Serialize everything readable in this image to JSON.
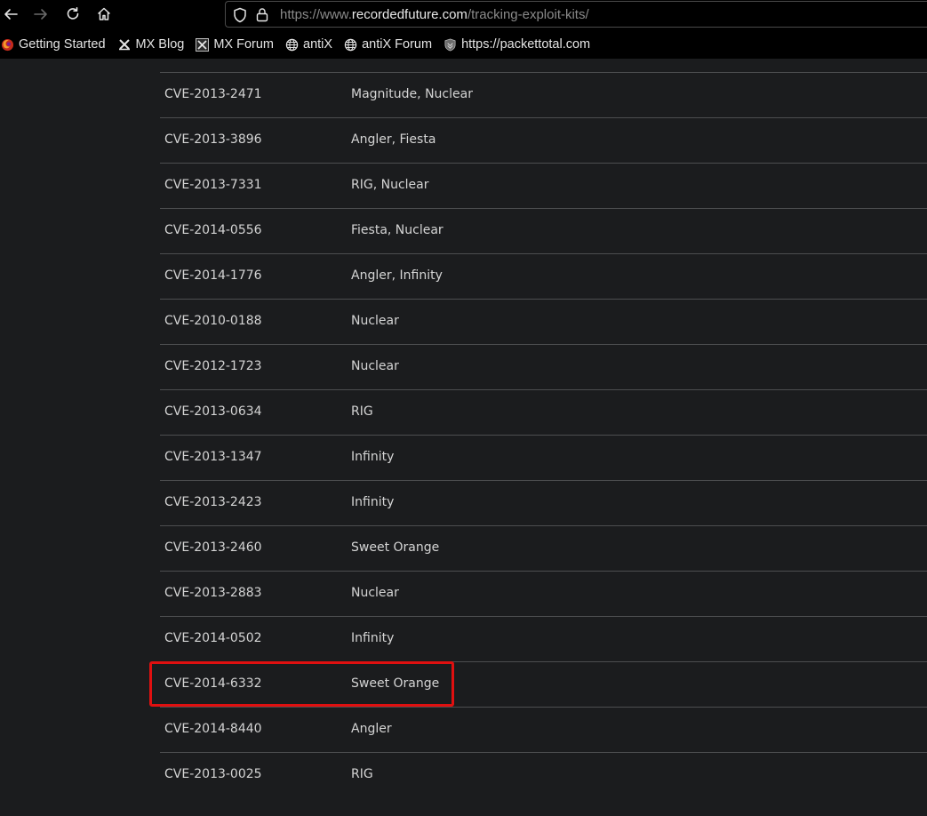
{
  "toolbar": {
    "back_icon": "arrow-left-icon",
    "forward_icon": "arrow-right-icon",
    "reload_icon": "reload-icon",
    "home_icon": "home-icon",
    "url_prefix": "https://www.",
    "url_domain": "recordedfuture.com",
    "url_path": "/tracking-exploit-kits/"
  },
  "bookmarks": [
    {
      "label": "Getting Started",
      "icon": "firefox-icon"
    },
    {
      "label": "MX Blog",
      "icon": "mx-logo-icon"
    },
    {
      "label": "MX Forum",
      "icon": "mx-logo-boxed-icon"
    },
    {
      "label": "antiX",
      "icon": "globe-icon"
    },
    {
      "label": "antiX Forum",
      "icon": "globe-icon"
    },
    {
      "label": "https://packettotal.com",
      "icon": "shield-logo-icon"
    }
  ],
  "table": {
    "rows": [
      {
        "cve": "CVE-2013-2471",
        "kits": "Magnitude, Nuclear"
      },
      {
        "cve": "CVE-2013-3896",
        "kits": "Angler, Fiesta"
      },
      {
        "cve": "CVE-2013-7331",
        "kits": "RIG, Nuclear"
      },
      {
        "cve": "CVE-2014-0556",
        "kits": "Fiesta, Nuclear"
      },
      {
        "cve": "CVE-2014-1776",
        "kits": "Angler, Infinity"
      },
      {
        "cve": "CVE-2010-0188",
        "kits": "Nuclear"
      },
      {
        "cve": "CVE-2012-1723",
        "kits": "Nuclear"
      },
      {
        "cve": "CVE-2013-0634",
        "kits": "RIG"
      },
      {
        "cve": "CVE-2013-1347",
        "kits": "Infinity"
      },
      {
        "cve": "CVE-2013-2423",
        "kits": "Infinity"
      },
      {
        "cve": "CVE-2013-2460",
        "kits": "Sweet Orange"
      },
      {
        "cve": "CVE-2013-2883",
        "kits": "Nuclear"
      },
      {
        "cve": "CVE-2014-0502",
        "kits": "Infinity"
      },
      {
        "cve": "CVE-2014-6332",
        "kits": "Sweet Orange"
      },
      {
        "cve": "CVE-2014-8440",
        "kits": "Angler"
      },
      {
        "cve": "CVE-2013-0025",
        "kits": "RIG"
      }
    ],
    "highlighted_cve": "CVE-2014-6332"
  },
  "colors": {
    "highlight": "#e01010",
    "background": "#1b1c1e"
  }
}
